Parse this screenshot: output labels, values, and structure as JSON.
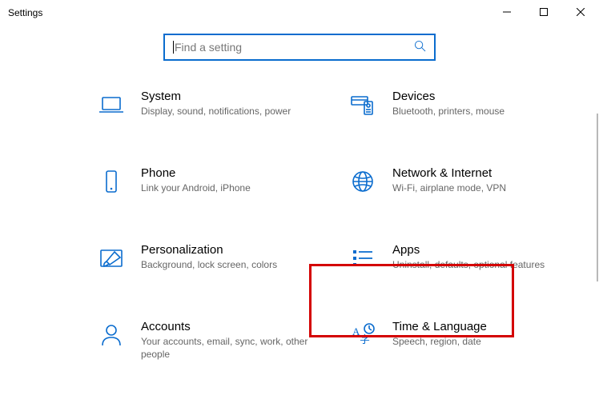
{
  "window": {
    "title": "Settings"
  },
  "search": {
    "placeholder": "Find a setting"
  },
  "categories": [
    {
      "title": "System",
      "desc": "Display, sound, notifications, power"
    },
    {
      "title": "Devices",
      "desc": "Bluetooth, printers, mouse"
    },
    {
      "title": "Phone",
      "desc": "Link your Android, iPhone"
    },
    {
      "title": "Network & Internet",
      "desc": "Wi-Fi, airplane mode, VPN"
    },
    {
      "title": "Personalization",
      "desc": "Background, lock screen, colors"
    },
    {
      "title": "Apps",
      "desc": "Uninstall, defaults, optional features"
    },
    {
      "title": "Accounts",
      "desc": "Your accounts, email, sync, work, other people"
    },
    {
      "title": "Time & Language",
      "desc": "Speech, region, date"
    }
  ],
  "highlighted_category_index": 5,
  "colors": {
    "accent": "#0a6cce",
    "highlight": "#d40000",
    "muted": "#666666"
  }
}
